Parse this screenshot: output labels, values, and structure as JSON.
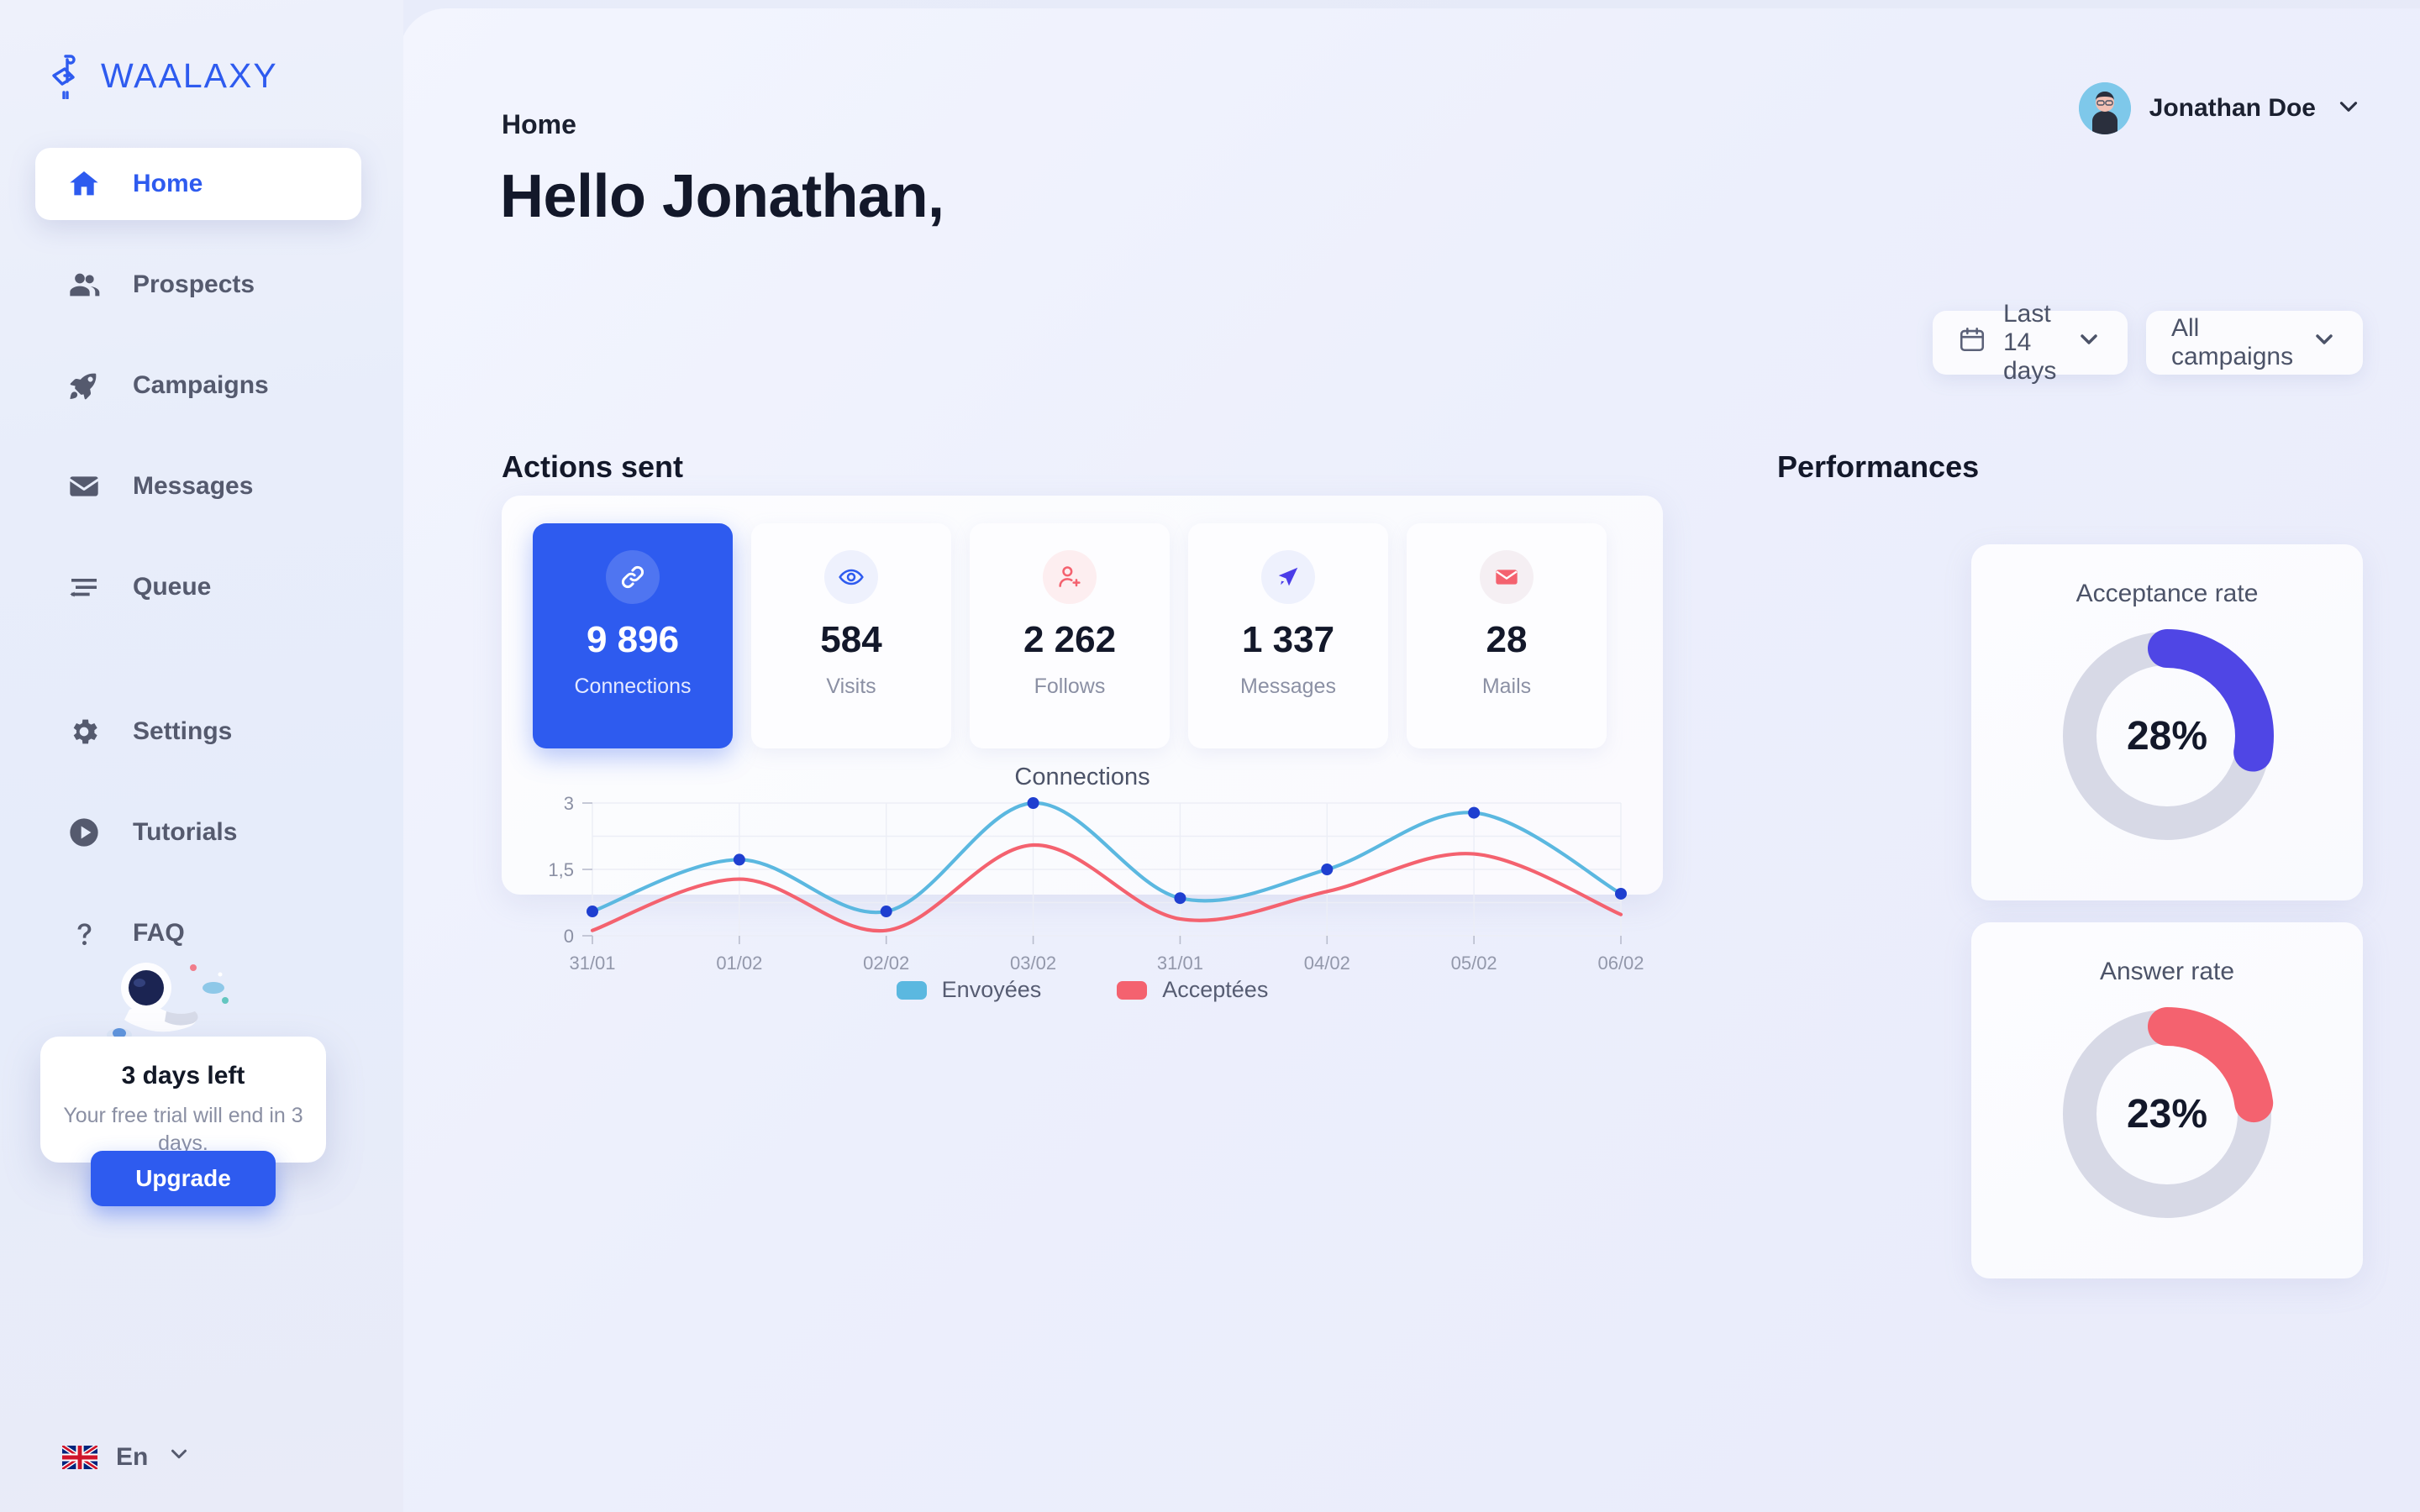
{
  "brand": {
    "name": "WAALAXY",
    "logo_icon": "flamingo-logo-icon",
    "color": "#2e5bef"
  },
  "sidebar": {
    "items": [
      {
        "label": "Home",
        "icon": "home-icon",
        "active": true
      },
      {
        "label": "Prospects",
        "icon": "people-icon",
        "active": false
      },
      {
        "label": "Campaigns",
        "icon": "rocket-icon",
        "active": false
      },
      {
        "label": "Messages",
        "icon": "envelope-icon",
        "active": false
      },
      {
        "label": "Queue",
        "icon": "queue-icon",
        "active": false
      },
      {
        "label": "Settings",
        "icon": "gear-icon",
        "active": false
      },
      {
        "label": "Tutorials",
        "icon": "play-circle-icon",
        "active": false
      },
      {
        "label": "FAQ",
        "icon": "question-mark-icon",
        "active": false
      }
    ],
    "trial": {
      "title": "3 days left",
      "subtitle": "Your free trial will end in 3 days.",
      "button": "Upgrade"
    },
    "language": {
      "label": "En",
      "flag": "uk-flag-icon",
      "chevron": "chevron-down-icon"
    }
  },
  "header": {
    "breadcrumb": "Home",
    "greeting": "Hello Jonathan,",
    "user": {
      "name": "Jonathan Doe",
      "avatar": "user-avatar",
      "chevron": "chevron-down-icon"
    }
  },
  "filters": {
    "date_range": {
      "label": "Last 14 days",
      "icon": "calendar-icon",
      "chevron": "chevron-down-icon"
    },
    "campaign": {
      "label": "All campaigns",
      "chevron": "chevron-down-icon"
    }
  },
  "sections": {
    "actions_sent": "Actions sent",
    "performances": "Performances"
  },
  "stats": [
    {
      "value": "9 896",
      "label": "Connections",
      "icon": "link-icon",
      "primary": true
    },
    {
      "value": "584",
      "label": "Visits",
      "icon": "eye-icon",
      "primary": false
    },
    {
      "value": "2 262",
      "label": "Follows",
      "icon": "user-plus-icon",
      "primary": false
    },
    {
      "value": "1 337",
      "label": "Messages",
      "icon": "send-icon",
      "primary": false
    },
    {
      "value": "28",
      "label": "Mails",
      "icon": "mail-icon",
      "primary": false
    }
  ],
  "performance": [
    {
      "title": "Acceptance rate",
      "value": "28%",
      "percent": 28,
      "color": "#4f46e5"
    },
    {
      "title": "Answer rate",
      "value": "23%",
      "percent": 23,
      "color": "#f4626f"
    }
  ],
  "chart_data": {
    "type": "line",
    "title": "Connections",
    "xlabel": "",
    "ylabel": "",
    "x": [
      "31/01",
      "01/02",
      "02/02",
      "03/02",
      "31/01",
      "04/02",
      "05/02",
      "06/02"
    ],
    "categories": [
      "31/01",
      "01/02",
      "02/02",
      "03/02",
      "31/01",
      "04/02",
      "05/02",
      "06/02"
    ],
    "yticks": [
      0,
      1.5,
      3
    ],
    "ytick_labels": [
      "0",
      "1,5",
      "3"
    ],
    "ylim": [
      0,
      3
    ],
    "grid": true,
    "legend_position": "bottom",
    "series": [
      {
        "name": "Envoyées",
        "color": "#5bb8e0",
        "values": [
          0.55,
          1.72,
          0.55,
          3.0,
          0.85,
          1.5,
          2.78,
          0.95
        ]
      },
      {
        "name": "Acceptées",
        "color": "#f4626f",
        "values": [
          0.12,
          1.28,
          0.12,
          2.05,
          0.38,
          1.0,
          1.85,
          0.48
        ]
      }
    ],
    "legend": [
      "Envoyées",
      "Acceptées"
    ]
  }
}
